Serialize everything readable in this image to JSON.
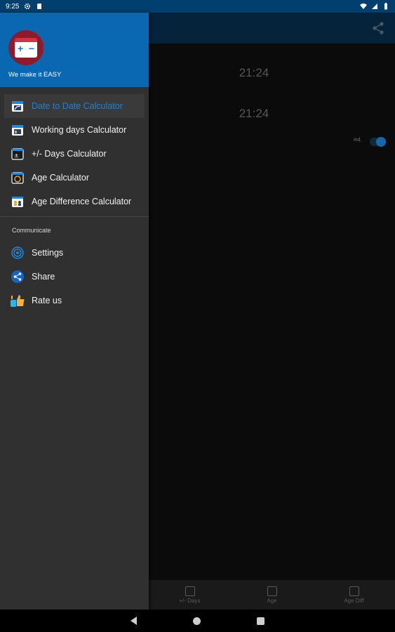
{
  "status_bar": {
    "time": "9:25",
    "icons": [
      "gear-icon",
      "sd-card-icon",
      "wifi-icon",
      "signal-icon",
      "battery-icon"
    ]
  },
  "app": {
    "time_top": "21:24",
    "time_bottom": "21:24",
    "toggle_label": "ind.",
    "toggle_on": true,
    "bottom_nav": [
      {
        "label": "+/- Days",
        "icon": "days-icon"
      },
      {
        "label": "Age",
        "icon": "age-icon"
      },
      {
        "label": "Age Diff",
        "icon": "age-diff-icon"
      }
    ]
  },
  "drawer": {
    "tagline": "We make it EASY",
    "items": [
      {
        "label": "Date to Date Calculator",
        "icon": "date-to-date-icon",
        "active": true
      },
      {
        "label": "Working days Calculator",
        "icon": "working-days-icon",
        "active": false
      },
      {
        "label": "+/- Days Calculator",
        "icon": "plus-minus-days-icon",
        "active": false
      },
      {
        "label": "Age Calculator",
        "icon": "age-calculator-icon",
        "active": false
      },
      {
        "label": "Age Difference Calculator",
        "icon": "age-difference-icon",
        "active": false
      }
    ],
    "section_title": "Communicate",
    "communicate_items": [
      {
        "label": "Settings",
        "icon": "settings-icon"
      },
      {
        "label": "Share",
        "icon": "share-icon"
      },
      {
        "label": "Rate us",
        "icon": "thumbs-up-icon"
      }
    ]
  },
  "colors": {
    "status_bar": "#003f6e",
    "drawer_header": "#0a67b1",
    "drawer_bg": "#303030",
    "active_text": "#2d7ec4",
    "toggle_accent": "#1668a8"
  }
}
